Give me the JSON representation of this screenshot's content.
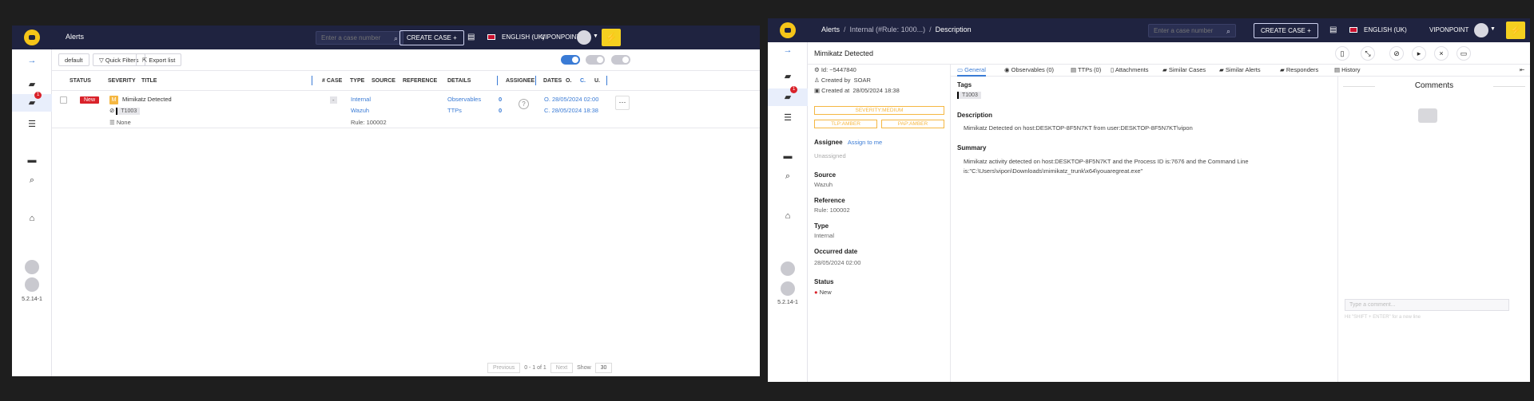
{
  "window1": {
    "breadcrumb": "Alerts",
    "search_placeholder": "Enter a case number",
    "create_case": "CREATE CASE",
    "language": "ENGLISH (UK)",
    "user": "VIPONPOINT",
    "sidebar": {
      "alerts_badge": "1",
      "version": "5.2.14-1"
    },
    "toolbar": {
      "filter_name": "default",
      "quick_filters": "Quick Filters",
      "export": "Export list"
    },
    "columns": [
      "STATUS",
      "SEVERITY",
      "TITLE",
      "# CASE",
      "TYPE",
      "SOURCE",
      "REFERENCE",
      "DETAILS",
      "ASSIGNEE",
      "DATES",
      "O.",
      "C.",
      "U."
    ],
    "row": {
      "status": "New",
      "severity": "M",
      "title": "Mimikatz Detected",
      "tag": "T1003",
      "tlp": "None",
      "case": "-",
      "type": "Internal",
      "source": "Wazuh",
      "reference": "Rule: 100002",
      "details_observables": "Observables",
      "details_observables_count": "0",
      "details_ttps": "TTPs",
      "details_ttps_count": "0",
      "assignee": "?",
      "date_o": "O. 28/05/2024 02:00",
      "date_c": "C. 28/05/2024 18:38"
    },
    "pager": {
      "previous": "Previous",
      "range": "0 - 1 of 1",
      "next": "Next",
      "show": "Show",
      "page_size": "30"
    }
  },
  "window2": {
    "breadcrumb": {
      "root": "Alerts",
      "mid": "Internal (#Rule: 1000...)",
      "leaf": "Description"
    },
    "search_placeholder": "Enter a case number",
    "create_case": "CREATE CASE",
    "language": "ENGLISH (UK)",
    "user": "VIPONPOINT",
    "sidebar": {
      "alerts_badge": "1",
      "version": "5.2.14-1"
    },
    "title": "Mimikatz Detected",
    "meta": {
      "id": "Id: ~5447840",
      "created_by_label": "Created by",
      "created_by": "SOAR",
      "created_at_label": "Created at",
      "created_at": "28/05/2024 18:38"
    },
    "pills": {
      "severity": "SEVERITY:MEDIUM",
      "tlp": "TLP:AMBER",
      "pap": "PAP:AMBER"
    },
    "assignee_label": "Assignee",
    "assign_to_me": "Assign to me",
    "unassigned": "Unassigned",
    "source_label": "Source",
    "source": "Wazuh",
    "reference_label": "Reference",
    "reference": "Rule: 100002",
    "type_label": "Type",
    "type": "Internal",
    "occurred_label": "Occurred date",
    "occurred": "28/05/2024 02:00",
    "status_label": "Status",
    "status": "New",
    "tabs": [
      "General",
      "Observables (0)",
      "TTPs (0)",
      "Attachments",
      "Similar Cases",
      "Similar Alerts",
      "Responders",
      "History"
    ],
    "tags_label": "Tags",
    "tag": "T1003",
    "description_label": "Description",
    "description": "Mimikatz Detected on host:DESKTOP-8F5N7KT from user:DESKTOP-8F5N7KT\\vipon",
    "summary_label": "Summary",
    "summary_line1": "Mimikatz activity detected on host:DESKTOP-8F5N7KT and the Process ID is:7676 and the Command Line",
    "summary_line2": "is:\"C:\\Users\\vipon\\Downloads\\mimikatz_trunk\\x64\\youaregreat.exe\"",
    "comments_title": "Comments",
    "comment_placeholder": "Type a comment...",
    "comment_hint": "Hit \"SHIFT + ENTER\" for a new line"
  },
  "colors": {
    "nav": "#1f2340",
    "accent": "#3a7bd5",
    "new": "#d9222a",
    "amber": "#f5b742",
    "bolt": "#f5d020"
  }
}
